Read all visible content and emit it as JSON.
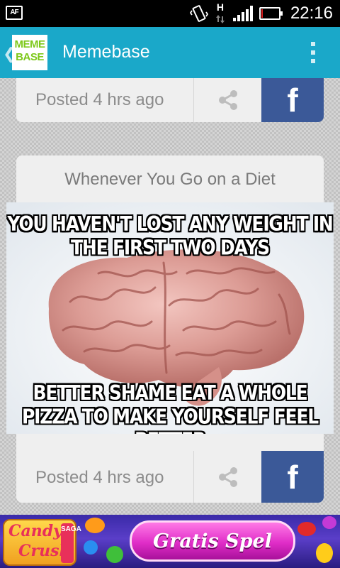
{
  "status_bar": {
    "app_icon_label": "AF",
    "network_type": "H",
    "time": "22:16",
    "battery_level": 0.1
  },
  "action_bar": {
    "logo_line1": "MEME",
    "logo_line2": "BASE",
    "title": "Memebase"
  },
  "feed": [
    {
      "posted": "Posted 4 hrs ago",
      "facebook_label": "f"
    },
    {
      "title": "Whenever You Go on a Diet",
      "meme_top": "YOU HAVEN'T LOST ANY WEIGHT IN THE FIRST TWO DAYS",
      "meme_bottom": "BETTER SHAME EAT A WHOLE PIZZA TO MAKE YOURSELF FEEL BETTER",
      "posted": "Posted 4 hrs ago",
      "facebook_label": "f"
    }
  ],
  "ad": {
    "logo_line1": "Candy",
    "logo_line2": "Crush",
    "logo_tag": "SAGA",
    "cta": "Gratis Spel"
  }
}
